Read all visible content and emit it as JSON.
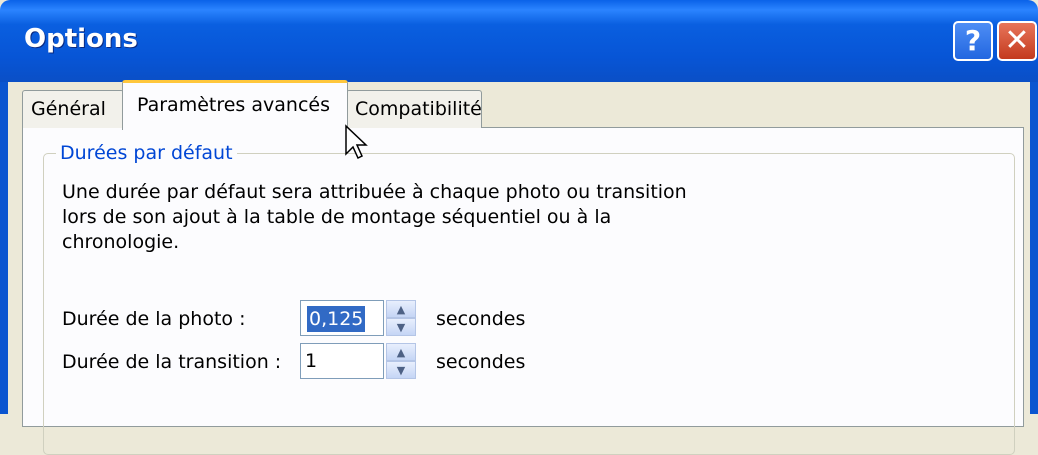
{
  "window": {
    "title": "Options",
    "help_glyph": "?",
    "close_glyph": "✕"
  },
  "tabs": [
    {
      "label": "Général",
      "active": false
    },
    {
      "label": "Paramètres avancés",
      "active": true
    },
    {
      "label": "Compatibilité",
      "active": false
    }
  ],
  "group": {
    "legend": "Durées par défaut",
    "description": "Une durée par défaut sera attribuée à chaque photo ou transition\nlors de son ajout à la table de montage séquentiel ou à la\nchronologie."
  },
  "fields": {
    "photo": {
      "label": "Durée de la photo :",
      "value": "0,125",
      "unit": "secondes"
    },
    "transition": {
      "label": "Durée de la transition :",
      "value": "1",
      "unit": "secondes"
    }
  },
  "colors": {
    "titlebar": "#0755d6",
    "accent_legend": "#0046d5",
    "selection": "#316ac5",
    "active_tab_highlight": "#ffc73c"
  },
  "icons": {
    "spin_up": "▲",
    "spin_down": "▼"
  }
}
